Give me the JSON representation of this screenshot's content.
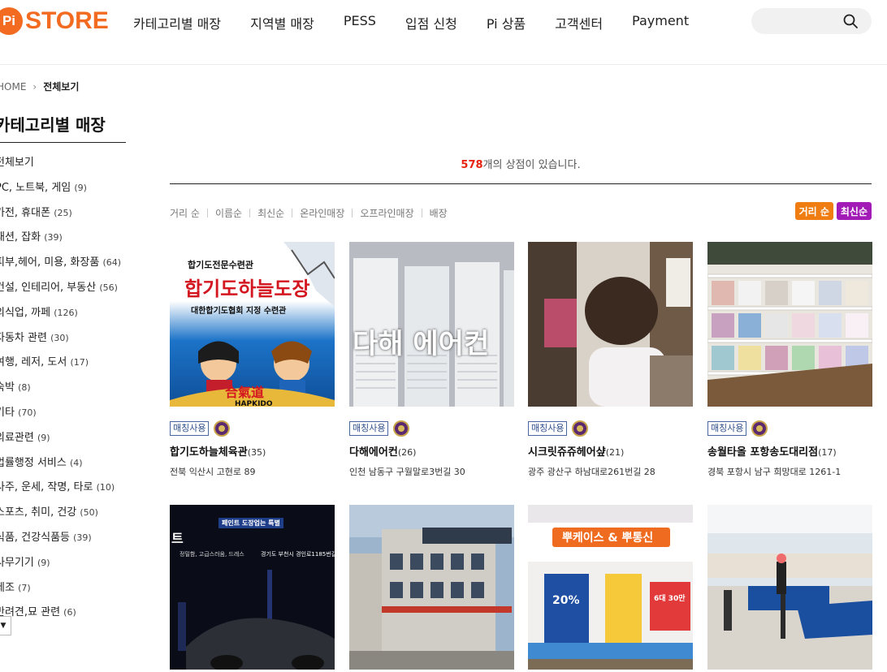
{
  "header": {
    "logo_badge": "Pi",
    "logo_text": "STORE",
    "nav": [
      "카테고리별 매장",
      "지역별 매장",
      "PESS",
      "입점 신청",
      "Pi 상품",
      "고객센터",
      "Payment"
    ]
  },
  "breadcrumb": {
    "home": "HOME",
    "current": "전체보기"
  },
  "sidebar": {
    "title": "카테고리별 매장",
    "items": [
      {
        "label": "전체보기",
        "count": ""
      },
      {
        "label": "PC, 노트북, 게임",
        "count": "(9)"
      },
      {
        "label": "가전, 휴대폰",
        "count": "(25)"
      },
      {
        "label": "패션, 잡화",
        "count": "(39)"
      },
      {
        "label": "피부,헤어, 미용, 화장품",
        "count": "(64)"
      },
      {
        "label": "건설, 인테리어, 부동산",
        "count": "(56)"
      },
      {
        "label": "외식업, 까페",
        "count": "(126)"
      },
      {
        "label": "자동차 관련",
        "count": "(30)"
      },
      {
        "label": "여행, 레저, 도서",
        "count": "(17)"
      },
      {
        "label": "숙박",
        "count": "(8)"
      },
      {
        "label": "기타",
        "count": "(70)"
      },
      {
        "label": "의료관련",
        "count": "(9)"
      },
      {
        "label": "법률행정 서비스",
        "count": "(4)"
      },
      {
        "label": "사주, 운세, 작명, 타로",
        "count": "(10)"
      },
      {
        "label": "스포츠, 취미, 건강",
        "count": "(50)"
      },
      {
        "label": "식품, 건강식품등",
        "count": "(39)"
      },
      {
        "label": "사무기기",
        "count": "(9)"
      },
      {
        "label": "제조",
        "count": "(7)"
      },
      {
        "label": "반려견,묘 관련",
        "count": "(6)"
      }
    ],
    "toggle_glyph": "▼"
  },
  "main": {
    "store_count": "578",
    "count_suffix": "개의 상점이 있습니다.",
    "sort_options": [
      "거리 순",
      "이름순",
      "최신순",
      "온라인매장",
      "오프라인매장",
      "배장"
    ],
    "badges": [
      {
        "label": "거리 순",
        "color": "#f07d12"
      },
      {
        "label": "최신순",
        "color": "#a21bb6"
      }
    ]
  },
  "cards": [
    {
      "tag": "매칭사용",
      "name": "합기도하늘체육관",
      "reviews": "(35)",
      "address": "전북 익산시 고현로 89",
      "image": {
        "theme": "hapkido",
        "lines": [
          "합기도전문수련관",
          "합기도하늘도장",
          "대한합기도협회 지정 수련관",
          "合氣道",
          "HAPKIDO"
        ]
      }
    },
    {
      "tag": "매칭사용",
      "name": "다해에어컨",
      "reviews": "(26)",
      "address": "인천 남동구 구월말로3번길 30",
      "image": {
        "theme": "aircon",
        "lines": [
          "다해 에어컨"
        ]
      }
    },
    {
      "tag": "매칭사용",
      "name": "시크릿쥬쥬헤어샾",
      "reviews": "(21)",
      "address": "광주 광산구 하남대로261번길 28",
      "image": {
        "theme": "hair",
        "lines": []
      }
    },
    {
      "tag": "매칭사용",
      "name": "송월타올 포항송도대리점",
      "reviews": "(17)",
      "address": "경북 포항시 남구 희망대로 1261-1",
      "image": {
        "theme": "towel",
        "lines": []
      }
    },
    {
      "tag": "",
      "name": "",
      "reviews": "",
      "address": "",
      "image": {
        "theme": "car",
        "lines": [
          "트",
          "페인트 도장업는 특별",
          "경기도 부천시 경인로1185번길",
          "정밀함, 고급스러움, 드레스"
        ]
      }
    },
    {
      "tag": "",
      "name": "",
      "reviews": "",
      "address": "",
      "image": {
        "theme": "building",
        "lines": []
      }
    },
    {
      "tag": "",
      "name": "",
      "reviews": "",
      "address": "",
      "image": {
        "theme": "shop",
        "lines": [
          "뿌케이스 & 뿌통신",
          "20%",
          "6대 30만"
        ]
      }
    },
    {
      "tag": "",
      "name": "",
      "reviews": "",
      "address": "",
      "image": {
        "theme": "pingpong",
        "lines": []
      }
    }
  ]
}
